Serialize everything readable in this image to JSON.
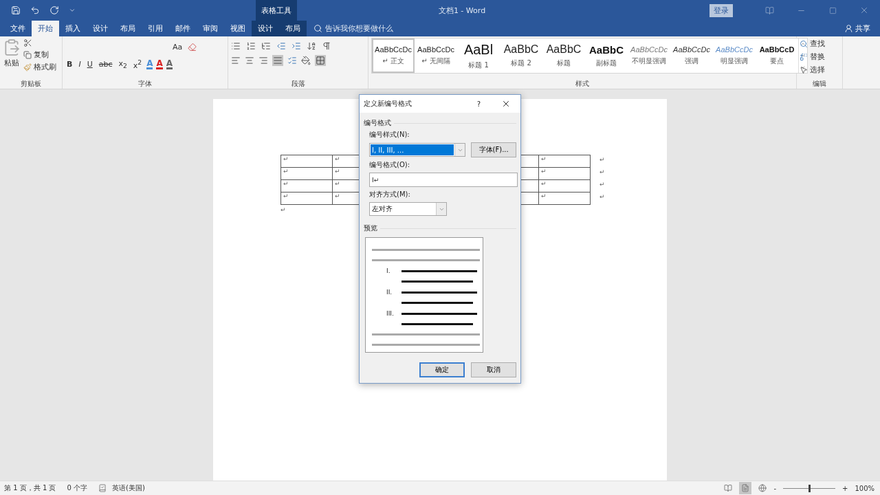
{
  "window": {
    "title": "文档1 - Word",
    "context_header": "表格工具",
    "login": "登录"
  },
  "tabs": [
    {
      "label": "文件",
      "selected": false,
      "contextual": false
    },
    {
      "label": "开始",
      "selected": true,
      "contextual": false
    },
    {
      "label": "插入",
      "selected": false,
      "contextual": false
    },
    {
      "label": "设计",
      "selected": false,
      "contextual": false
    },
    {
      "label": "布局",
      "selected": false,
      "contextual": false
    },
    {
      "label": "引用",
      "selected": false,
      "contextual": false
    },
    {
      "label": "邮件",
      "selected": false,
      "contextual": false
    },
    {
      "label": "审阅",
      "selected": false,
      "contextual": false
    },
    {
      "label": "视图",
      "selected": false,
      "contextual": false
    },
    {
      "label": "设计",
      "selected": false,
      "contextual": true
    },
    {
      "label": "布局",
      "selected": false,
      "contextual": true
    }
  ],
  "tell_me": {
    "placeholder": "告诉我你想要做什么"
  },
  "share": "共享",
  "ribbon": {
    "clipboard": {
      "label": "剪贴板",
      "paste": "粘贴",
      "copy": "复制",
      "format_painter": "格式刷"
    },
    "font": {
      "label": "字体",
      "case": "Aa",
      "buttons": [
        {
          "text": "B",
          "kind": "bold"
        },
        {
          "text": "I",
          "kind": "italic"
        },
        {
          "text": "U",
          "kind": "underline"
        },
        {
          "text": "abc",
          "kind": "strike"
        },
        {
          "text": "x$_{2}$",
          "kind": "plain"
        },
        {
          "text": "x$^{2}$",
          "kind": "plain"
        }
      ],
      "effects": [
        {
          "text": "A",
          "color": "#4a8fd8"
        },
        {
          "text": "A",
          "color": "#d92020"
        },
        {
          "text": "A",
          "color": "#666666"
        }
      ]
    },
    "paragraph": {
      "label": "段落"
    },
    "styles": {
      "label": "样式",
      "items": [
        {
          "preview": "AaBbCcDc",
          "name": "正文",
          "mark": "↵",
          "kind": "normal",
          "selected": true
        },
        {
          "preview": "AaBbCcDc",
          "name": "无间隔",
          "mark": "↵",
          "kind": "normal",
          "selected": false
        },
        {
          "preview": "AaBl",
          "name": "标题 1",
          "kind": "h1",
          "selected": false
        },
        {
          "preview": "AaBbC",
          "name": "标题 2",
          "kind": "h2",
          "selected": false
        },
        {
          "preview": "AaBbC",
          "name": "标题",
          "kind": "h2",
          "selected": false
        },
        {
          "preview": "AaBbC",
          "name": "副标题",
          "kind": "bold",
          "selected": false
        },
        {
          "preview": "AaBbCcDc",
          "name": "不明显强调",
          "kind": "subtle",
          "selected": false
        },
        {
          "preview": "AaBbCcDc",
          "name": "强调",
          "kind": "italic",
          "selected": false
        },
        {
          "preview": "AaBbCcDc",
          "name": "明显强调",
          "kind": "intense",
          "selected": false
        },
        {
          "preview": "AaBbCcD",
          "name": "要点",
          "kind": "strong",
          "selected": false
        }
      ]
    },
    "editing": {
      "label": "编辑",
      "find": "查找",
      "replace": "替换",
      "select": "选择"
    }
  },
  "table": {
    "rows": [
      {
        "left": [
          "↵",
          "↵"
        ],
        "right": [
          "↵"
        ],
        "end": "↵"
      },
      {
        "left": [
          "↵",
          "↵"
        ],
        "right": [
          "↵"
        ],
        "end": "↵"
      },
      {
        "left": [
          "↵",
          "↵"
        ],
        "right": [
          "↵"
        ],
        "end": "↵"
      },
      {
        "left": [
          "↵",
          "↵"
        ],
        "right": [
          "↵"
        ],
        "end": "↵"
      }
    ],
    "after": "↵"
  },
  "dialog": {
    "title": "定义新编号格式",
    "help": "?",
    "section_format": "编号格式",
    "style_label": "编号样式(N):",
    "style_value": "I, II, III, ...",
    "font_button": "字体(F)...",
    "format_label": "编号格式(O):",
    "format_value": "I↵",
    "align_label": "对齐方式(M):",
    "align_value": "左对齐",
    "section_preview": "预览",
    "preview_numbers": [
      "I.",
      "II.",
      "III."
    ],
    "ok": "确定",
    "cancel": "取消"
  },
  "status_bar": {
    "page": "第 1 页，共 1 页",
    "words": "0 个字",
    "language": "英语(美国)",
    "zoom": "100%",
    "zoom_minus": "-",
    "zoom_plus": "+",
    "zoom_level": {
      "level": 0.5
    }
  }
}
